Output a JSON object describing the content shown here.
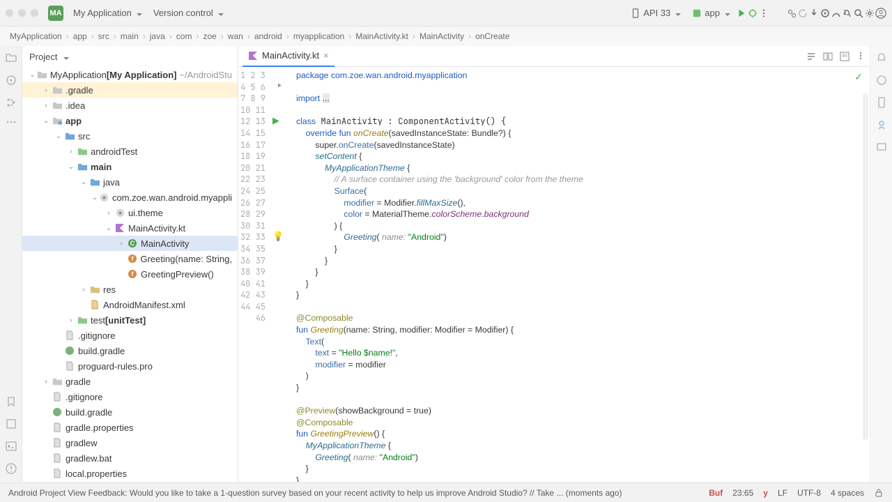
{
  "title": {
    "app_badge": "MA",
    "app_name": "My Application",
    "vcs": "Version control"
  },
  "toolbar": {
    "device": "API 33",
    "config": "app"
  },
  "breadcrumb": [
    "MyApplication",
    "app",
    "src",
    "main",
    "java",
    "com",
    "zoe",
    "wan",
    "android",
    "myapplication",
    "MainActivity.kt",
    "MainActivity",
    "onCreate"
  ],
  "panel_title": "Project",
  "tree": [
    {
      "d": 0,
      "exp": "v",
      "icon": "folder",
      "label": "MyApplication",
      "bold": "[My Application]",
      "suffix": "~/AndroidStu"
    },
    {
      "d": 1,
      "exp": ">",
      "icon": "folder",
      "label": ".gradle",
      "hilite": true
    },
    {
      "d": 1,
      "exp": ">",
      "icon": "folder",
      "label": ".idea"
    },
    {
      "d": 1,
      "exp": "v",
      "icon": "folder-app",
      "label": "app",
      "boldLabel": true
    },
    {
      "d": 2,
      "exp": "v",
      "icon": "folder-blue",
      "label": "src"
    },
    {
      "d": 3,
      "exp": ">",
      "icon": "folder-green",
      "label": "androidTest"
    },
    {
      "d": 3,
      "exp": "v",
      "icon": "folder-blue",
      "label": "main",
      "boldLabel": true
    },
    {
      "d": 4,
      "exp": "v",
      "icon": "folder-blue",
      "label": "java"
    },
    {
      "d": 5,
      "exp": "v",
      "icon": "pkg",
      "label": "com.zoe.wan.android.myappli"
    },
    {
      "d": 6,
      "exp": ">",
      "icon": "pkg",
      "label": "ui.theme"
    },
    {
      "d": 6,
      "exp": "v",
      "icon": "kt",
      "label": "MainActivity.kt"
    },
    {
      "d": 7,
      "exp": ">",
      "icon": "class",
      "label": "MainActivity",
      "sel": true
    },
    {
      "d": 7,
      "exp": "",
      "icon": "func",
      "label": "Greeting(name: String,"
    },
    {
      "d": 7,
      "exp": "",
      "icon": "func",
      "label": "GreetingPreview()"
    },
    {
      "d": 4,
      "exp": ">",
      "icon": "folder-res",
      "label": "res"
    },
    {
      "d": 4,
      "exp": "",
      "icon": "xml",
      "label": "AndroidManifest.xml"
    },
    {
      "d": 3,
      "exp": ">",
      "icon": "folder-green",
      "label": "test",
      "bold": "[unitTest]"
    },
    {
      "d": 2,
      "exp": "",
      "icon": "file",
      "label": ".gitignore"
    },
    {
      "d": 2,
      "exp": "",
      "icon": "gradle",
      "label": "build.gradle"
    },
    {
      "d": 2,
      "exp": "",
      "icon": "file",
      "label": "proguard-rules.pro"
    },
    {
      "d": 1,
      "exp": ">",
      "icon": "folder",
      "label": "gradle"
    },
    {
      "d": 1,
      "exp": "",
      "icon": "file",
      "label": ".gitignore"
    },
    {
      "d": 1,
      "exp": "",
      "icon": "gradle",
      "label": "build.gradle"
    },
    {
      "d": 1,
      "exp": "",
      "icon": "file",
      "label": "gradle.properties"
    },
    {
      "d": 1,
      "exp": "",
      "icon": "file",
      "label": "gradlew"
    },
    {
      "d": 1,
      "exp": "",
      "icon": "file",
      "label": "gradlew.bat"
    },
    {
      "d": 1,
      "exp": "",
      "icon": "file",
      "label": "local.properties"
    }
  ],
  "tab": {
    "name": "MainActivity.kt"
  },
  "gutter_start": 1,
  "gutter_end": 46,
  "status": {
    "msg": "Android Project View Feedback: Would you like to take a 1-question survey based on your recent activity to help us improve Android Studio? // Take ... (moments ago)",
    "buf": "Buf",
    "line_col": "23:65",
    "lf": "LF",
    "enc": "UTF-8",
    "indent": "4 spaces"
  },
  "code": {
    "l1": "package com.zoe.wan.android.myapplication",
    "l3a": "import ",
    "l3b": "...",
    "l5": "class MainActivity : ComponentActivity() {",
    "l6a": "    override fun ",
    "l6b": "onCreate",
    "l6c": "(savedInstanceState: Bundle?) {",
    "l7a": "        super.",
    "l7b": "onCreate",
    "l7c": "(savedInstanceState)",
    "l8a": "        ",
    "l8b": "setContent",
    "l8c": " {",
    "l9a": "            ",
    "l9b": "MyApplicationTheme",
    "l9c": " {",
    "l10": "                // A surface container using the 'background' color from the theme",
    "l11a": "                ",
    "l11b": "Surface",
    "l11c": "(",
    "l12a": "                    ",
    "l12b": "modifier",
    "l12c": " = Modifier.",
    "l12d": "fillMaxSize",
    "l12e": "(),",
    "l13a": "                    ",
    "l13b": "color",
    "l13c": " = MaterialTheme.",
    "l13d": "colorScheme",
    "l13e": ".",
    "l13f": "background",
    "l14": "                ) {",
    "l15a": "                    ",
    "l15b": "Greeting",
    "l15c": "(",
    "l15d": " name: ",
    "l15e": "\"Android\"",
    "l15f": ")",
    "l16": "                }",
    "l17": "            }",
    "l18": "        }",
    "l19": "    }",
    "l20": "}",
    "l22a": "@Composable",
    "l23a": "fun ",
    "l23b": "Greeting",
    "l23c": "(name: String, modifier: Modifier = Modifier) {",
    "l24a": "    ",
    "l24b": "Text",
    "l24c": "(",
    "l25a": "        ",
    "l25b": "text",
    "l25c": " = ",
    "l25d": "\"Hello $name!\"",
    "l25e": ",",
    "l26a": "        ",
    "l26b": "modifier",
    "l26c": " = modifier",
    "l27": "    )",
    "l28": "}",
    "l30a": "@Preview",
    "l30b": "(showBackground = true)",
    "l31": "@Composable",
    "l32a": "fun ",
    "l32b": "GreetingPreview",
    "l32c": "() {",
    "l33a": "    ",
    "l33b": "MyApplicationTheme",
    "l33c": " {",
    "l34a": "        ",
    "l34b": "Greeting",
    "l34c": "(",
    "l34d": " name: ",
    "l34e": "\"Android\"",
    "l34f": ")",
    "l35": "    }",
    "l36": "}"
  }
}
